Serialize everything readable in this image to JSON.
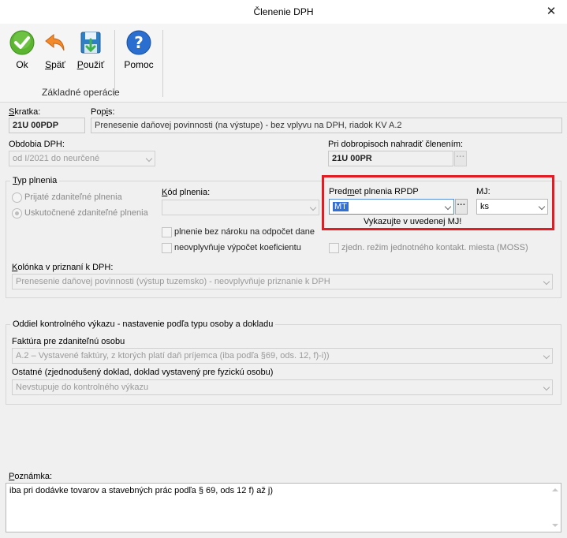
{
  "window": {
    "title": "Členenie DPH",
    "close_label": "✕"
  },
  "toolbar": {
    "ok_label": "Ok",
    "back_label": "Späť",
    "apply_label": "Použiť",
    "help_label": "Pomoc",
    "group_label": "Základné operácie"
  },
  "form": {
    "shortcut_label": "Skratka:",
    "shortcut_value": "21U 00PDP",
    "description_label": "Popis:",
    "description_value": "Prenesenie daňovej povinnosti  (na výstupe) - bez vplyvu na DPH, riadok KV A.2",
    "periods_label": "Obdobia DPH:",
    "periods_value": "od I/2021 do neurčené",
    "credit_replace_label": "Pri dobropisoch nahradiť členením:",
    "credit_replace_value": "21U 00PR",
    "supply_type": {
      "title": "Typ plnenia",
      "received_label": "Prijaté zdaniteľné plnenia",
      "performed_label": "Uskutočnené zdaniteľné plnenia"
    },
    "supply_code_label": "Kód plnenia:",
    "supply_code_value": "",
    "no_deduction_label": "plnenie bez nároku na odpočet dane",
    "no_coefficient_label": "neovplyvňuje výpočet koeficientu",
    "oss_label": "zjedn. režim jednotného kontakt. miesta (MOSS)",
    "rpdp_subject_label": "Predmet plnenia RPDP",
    "rpdp_subject_value": "MT",
    "unit_label": "MJ:",
    "unit_value": "ks",
    "unit_note": "Vykazujte v uvedenej MJ!",
    "vat_column_label": "Kolónka v priznaní k DPH:",
    "vat_column_value": "Prenesenie daňovej povinnosti (výstup tuzemsko) - neovplyvňuje priznanie k DPH"
  },
  "control_statement": {
    "title": "Oddiel kontrolného výkazu - nastavenie podľa typu osoby a dokladu",
    "invoice_label": "Faktúra pre zdaniteľnú osobu",
    "invoice_value": "A.2 – Vystavené faktúry, z ktorých platí daň príjemca (iba podľa §69, ods. 12, f)-i))",
    "other_label": "Ostatné (zjednodušený doklad, doklad vystavený pre fyzickú osobu)",
    "other_value": "Nevstupuje do kontrolného výkazu"
  },
  "note": {
    "label": "Poznámka:",
    "value": "iba pri dodávke tovarov a stavebných prác podľa § 69, ods 12 f) až j)"
  },
  "icons": [
    "check-icon",
    "back-arrow-icon",
    "save-download-icon",
    "help-icon",
    "close-icon",
    "chevron-down-icon",
    "ellipsis-icon"
  ],
  "colors": {
    "accent_red": "#e41b23",
    "ok_green": "#5cb531",
    "help_blue": "#2a6fd0",
    "selection": "#3370d6"
  }
}
